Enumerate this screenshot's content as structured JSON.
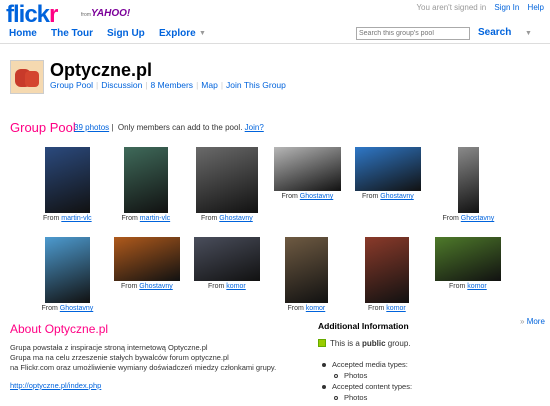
{
  "header": {
    "logo_a": "flick",
    "logo_b": "r",
    "logo_from": "from",
    "logo_yahoo": "YAHOO!",
    "status": "You aren't signed in",
    "signin": "Sign In",
    "help": "Help"
  },
  "nav": {
    "home": "Home",
    "tour": "The Tour",
    "signup": "Sign Up",
    "explore": "Explore",
    "search_placeholder": "Search this group's pool",
    "search": "Search"
  },
  "group": {
    "name": "Optyczne.pl",
    "links": [
      "Group Pool",
      "Discussion",
      "8 Members",
      "Map",
      "Join This Group"
    ]
  },
  "pool": {
    "title": "Group Pool",
    "count": "39 photos",
    "sep": "|",
    "note": "Only members can add to the pool.",
    "join": "Join?",
    "from": "From",
    "photos": [
      {
        "by": "martin-vlc",
        "color": "#2b4a7e"
      },
      {
        "by": "martin-vlc",
        "color": "#3f6a5a"
      },
      {
        "by": "Ghostavny",
        "color": "#6a6a6a"
      },
      {
        "by": "Ghostavny",
        "color": "#b7b7b7"
      },
      {
        "by": "Ghostavny",
        "color": "#2f78c8"
      },
      {
        "by": "Ghostavny",
        "color": "#8a8a8a"
      },
      {
        "by": "Ghostavny",
        "color": "#4d9bd0"
      },
      {
        "by": "Ghostavny",
        "color": "#b05a1c"
      },
      {
        "by": "komor",
        "color": "#4a4e5c"
      },
      {
        "by": "komor",
        "color": "#6e5a42"
      },
      {
        "by": "komor",
        "color": "#8a3a2a"
      },
      {
        "by": "komor",
        "color": "#4e7a2a"
      }
    ],
    "more": "More"
  },
  "about": {
    "title": "About Optyczne.pl",
    "lines": [
      "Grupa powstała z inspiracje stroną internetową Optyczne.pl",
      "Grupa ma na celu zrzeszenie stałych bywalców forum optyczne.pl",
      "na Flickr.com oraz umożliwienie wymiany doświadczeń miedzy członkami grupy."
    ],
    "url": "http://optyczne.pl/index.php"
  },
  "info": {
    "title": "Additional Information",
    "public_pre": "This is a ",
    "public_word": "public",
    "public_post": " group.",
    "media_label": "Accepted media types:",
    "media_value": "Photos",
    "content_label": "Accepted content types:",
    "content_value": "Photos"
  }
}
